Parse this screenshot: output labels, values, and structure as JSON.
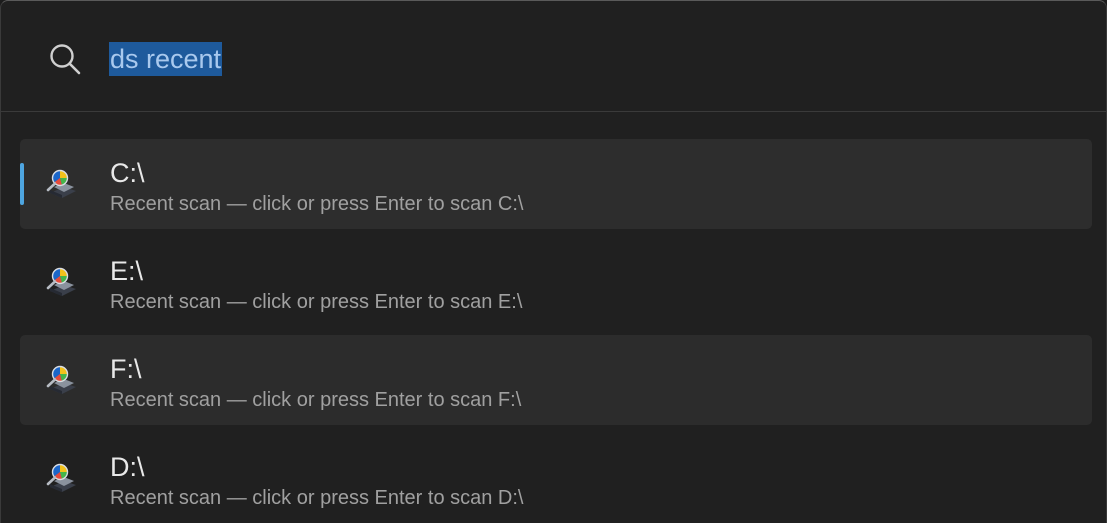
{
  "search": {
    "query": "ds recent"
  },
  "results": [
    {
      "title": "C:\\",
      "subtitle": "Recent scan — click or press Enter to scan C:\\",
      "icon": "disk-scan-icon"
    },
    {
      "title": "E:\\",
      "subtitle": "Recent scan — click or press Enter to scan E:\\",
      "icon": "disk-scan-icon"
    },
    {
      "title": "F:\\",
      "subtitle": "Recent scan — click or press Enter to scan F:\\",
      "icon": "disk-scan-icon"
    },
    {
      "title": "D:\\",
      "subtitle": "Recent scan — click or press Enter to scan D:\\",
      "icon": "disk-scan-icon"
    }
  ],
  "colors": {
    "background": "#202020",
    "accent": "#4ea5e0",
    "selection": "#1e5a9c",
    "row_highlight": "#2c2c2c"
  }
}
